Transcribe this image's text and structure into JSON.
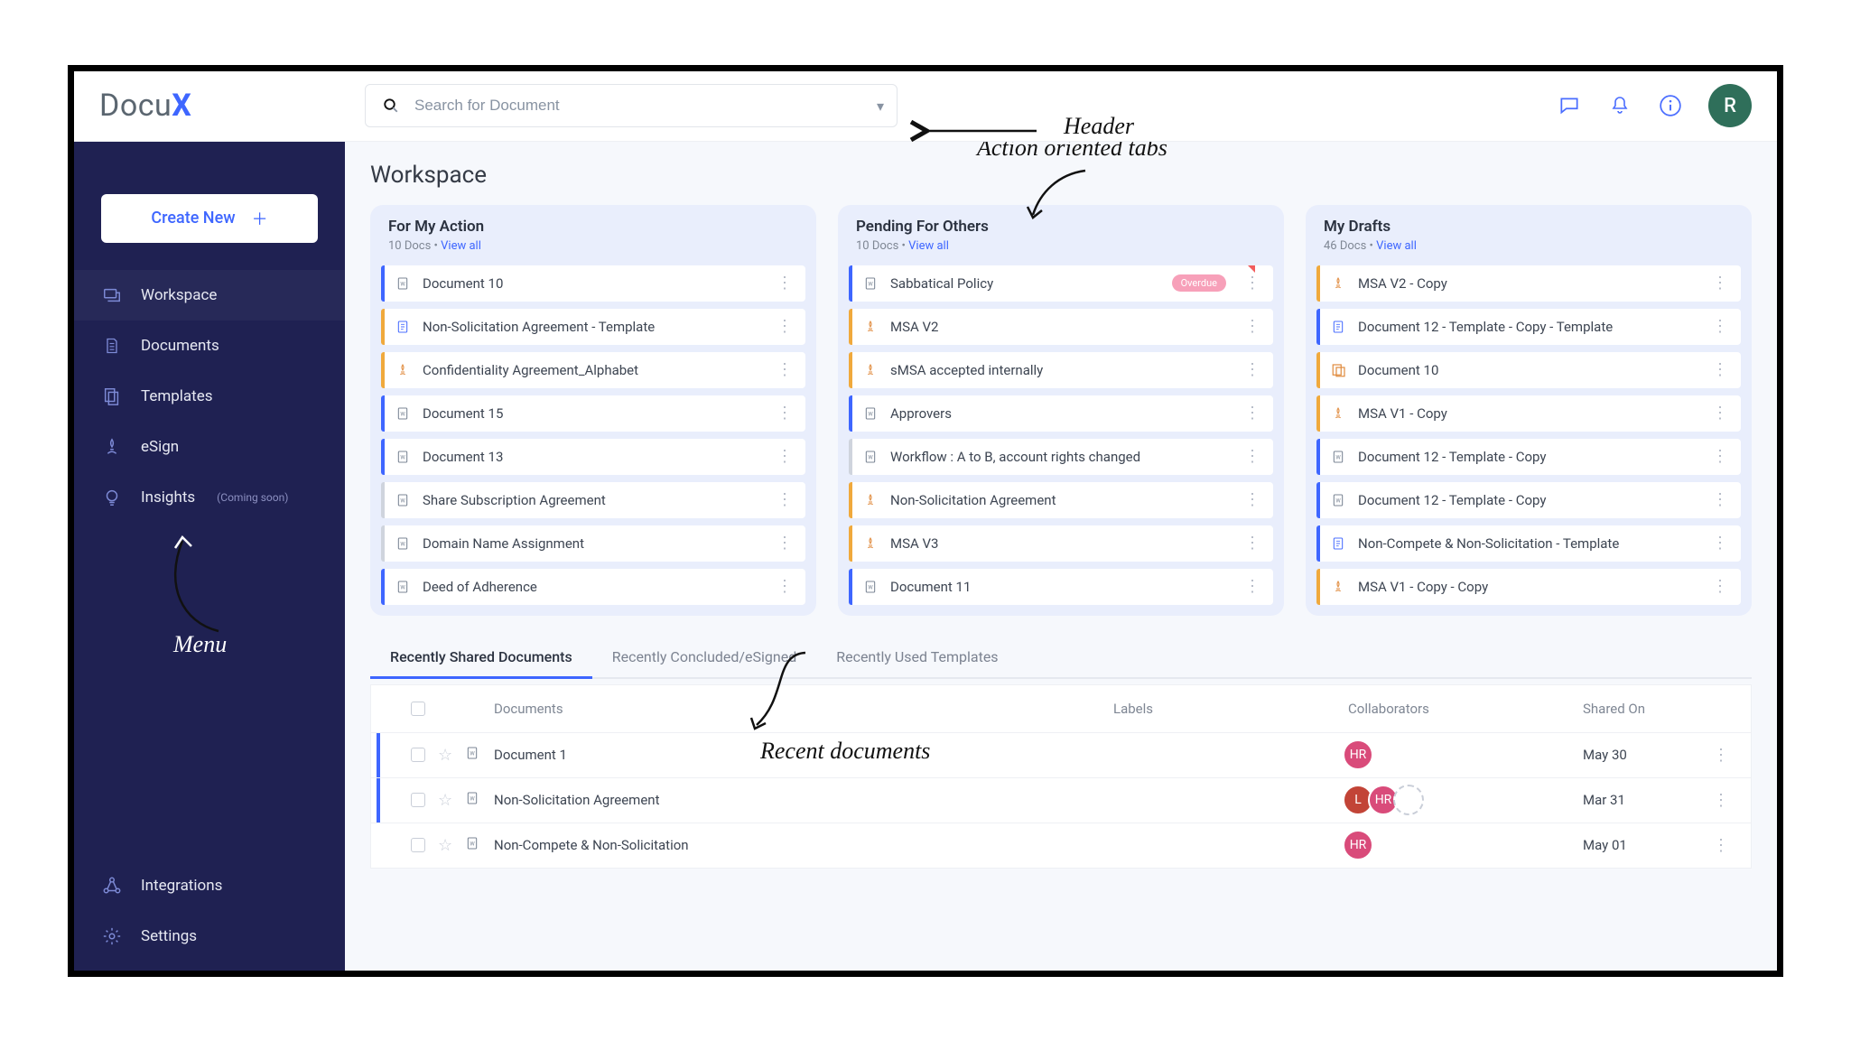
{
  "logo": {
    "text": "Docu",
    "suffix": "X"
  },
  "search": {
    "placeholder": "Search for Document"
  },
  "avatar": {
    "letter": "R"
  },
  "annotations": {
    "header": "Header",
    "tabs": "Action oriented tabs",
    "menu": "Menu",
    "recent": "Recent documents"
  },
  "create_label": "Create New",
  "sidebar": {
    "items": [
      {
        "label": "Workspace"
      },
      {
        "label": "Documents"
      },
      {
        "label": "Templates"
      },
      {
        "label": "eSign"
      },
      {
        "label": "Insights",
        "hint": "(Coming soon)"
      }
    ],
    "bottom": [
      {
        "label": "Integrations"
      },
      {
        "label": "Settings"
      }
    ]
  },
  "page_title": "Workspace",
  "columns": [
    {
      "title": "For My Action",
      "count": "10 Docs",
      "viewall": "View all",
      "items": [
        {
          "stripe": "blue",
          "icon": "w",
          "name": "Document 10"
        },
        {
          "stripe": "orange",
          "icon": "t",
          "name": "Non-Solicitation Agreement - Template"
        },
        {
          "stripe": "orange",
          "icon": "s",
          "name": "Confidentiality Agreement_Alphabet"
        },
        {
          "stripe": "blue",
          "icon": "w",
          "name": "Document 15"
        },
        {
          "stripe": "blue",
          "icon": "w",
          "name": "Document 13"
        },
        {
          "stripe": "gray",
          "icon": "w",
          "name": "Share Subscription Agreement"
        },
        {
          "stripe": "gray",
          "icon": "w",
          "name": "Domain Name Assignment"
        },
        {
          "stripe": "blue",
          "icon": "w",
          "name": "Deed of Adherence"
        }
      ]
    },
    {
      "title": "Pending For Others",
      "count": "10 Docs",
      "viewall": "View all",
      "items": [
        {
          "stripe": "blue",
          "icon": "w",
          "name": "Sabbatical Policy",
          "badge": "Overdue",
          "corner": true
        },
        {
          "stripe": "orange",
          "icon": "s",
          "name": "MSA V2"
        },
        {
          "stripe": "orange",
          "icon": "s",
          "name": "sMSA accepted internally"
        },
        {
          "stripe": "blue",
          "icon": "w",
          "name": "Approvers"
        },
        {
          "stripe": "gray",
          "icon": "w",
          "name": "Workflow : A to B, account rights changed"
        },
        {
          "stripe": "orange",
          "icon": "s",
          "name": "Non-Solicitation Agreement"
        },
        {
          "stripe": "orange",
          "icon": "s",
          "name": "MSA V3"
        },
        {
          "stripe": "blue",
          "icon": "w",
          "name": "Document 11"
        }
      ]
    },
    {
      "title": "My Drafts",
      "count": "46 Docs",
      "viewall": "View all",
      "items": [
        {
          "stripe": "orange",
          "icon": "s",
          "name": "MSA V2 - Copy"
        },
        {
          "stripe": "blue",
          "icon": "t",
          "name": "Document 12 - Template - Copy - Template"
        },
        {
          "stripe": "orange",
          "icon": "t2",
          "name": "Document 10"
        },
        {
          "stripe": "orange",
          "icon": "s",
          "name": "MSA V1 - Copy"
        },
        {
          "stripe": "blue",
          "icon": "w",
          "name": "Document 12 - Template - Copy"
        },
        {
          "stripe": "blue",
          "icon": "w",
          "name": "Document 12 - Template - Copy"
        },
        {
          "stripe": "blue",
          "icon": "t",
          "name": "Non-Compete & Non-Solicitation - Template"
        },
        {
          "stripe": "orange",
          "icon": "s",
          "name": "MSA V1 - Copy - Copy"
        }
      ]
    }
  ],
  "recent_tabs": [
    "Recently Shared Documents",
    "Recently Concluded/eSigned",
    "Recently Used Templates"
  ],
  "table": {
    "headers": {
      "doc": "Documents",
      "labels": "Labels",
      "collab": "Collaborators",
      "shared": "Shared On"
    },
    "rows": [
      {
        "stripe": true,
        "name": "Document 1",
        "collab": [
          {
            "t": "HR",
            "c": "hr"
          }
        ],
        "date": "May 30"
      },
      {
        "stripe": true,
        "name": "Non-Solicitation Agreement",
        "collab": [
          {
            "t": "L",
            "c": "l"
          },
          {
            "t": "HR",
            "c": "hr"
          },
          {
            "t": "",
            "c": "empty"
          }
        ],
        "date": "Mar 31"
      },
      {
        "stripe": false,
        "name": "Non-Compete & Non-Solicitation",
        "collab": [
          {
            "t": "HR",
            "c": "hr"
          }
        ],
        "date": "May 01"
      }
    ]
  }
}
